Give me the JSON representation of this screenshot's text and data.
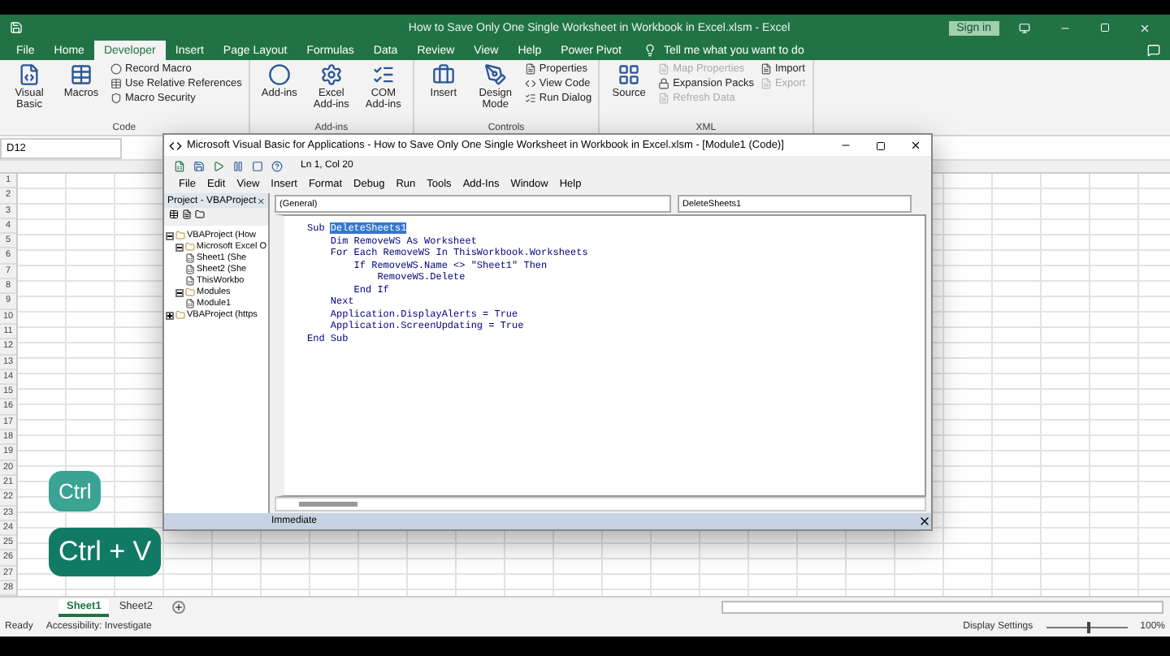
{
  "excel": {
    "title": "How to Save Only One Single Worksheet in Workbook in Excel.xlsm  -  Excel",
    "sign_in": "Sign in",
    "tabs": [
      {
        "label": "File",
        "selected": false
      },
      {
        "label": "Home",
        "selected": false
      },
      {
        "label": "Developer",
        "selected": true
      },
      {
        "label": "Insert",
        "selected": false
      },
      {
        "label": "Page Layout",
        "selected": false
      },
      {
        "label": "Formulas",
        "selected": false
      },
      {
        "label": "Data",
        "selected": false
      },
      {
        "label": "Review",
        "selected": false
      },
      {
        "label": "View",
        "selected": false
      },
      {
        "label": "Help",
        "selected": false
      },
      {
        "label": "Power Pivot",
        "selected": false
      }
    ],
    "tell_me": "Tell me what you want to do",
    "ribbon_groups": [
      {
        "name": "Code",
        "large": [
          "Visual Basic",
          "Macros"
        ],
        "small_columns": [
          [
            {
              "label": "Record Macro",
              "disabled": false
            },
            {
              "label": "Use Relative References",
              "disabled": false
            },
            {
              "label": "Macro Security",
              "disabled": false
            }
          ]
        ]
      },
      {
        "name": "Add-ins",
        "large": [
          "Add-ins",
          "Excel Add-ins",
          "COM Add-ins"
        ]
      },
      {
        "name": "Controls",
        "large": [
          "Insert",
          "Design Mode"
        ],
        "small_columns": [
          [
            {
              "label": "Properties",
              "disabled": false
            },
            {
              "label": "View Code",
              "disabled": false
            },
            {
              "label": "Run Dialog",
              "disabled": false
            }
          ]
        ]
      },
      {
        "name": "XML",
        "large": [
          "Source"
        ],
        "small_columns": [
          [
            {
              "label": "Map Properties",
              "disabled": true
            },
            {
              "label": "Expansion Packs",
              "disabled": false
            },
            {
              "label": "Refresh Data",
              "disabled": true
            }
          ],
          [
            {
              "label": "Import",
              "disabled": false
            },
            {
              "label": "Export",
              "disabled": true
            }
          ]
        ]
      }
    ],
    "name_box": "D12",
    "rows": [
      "1",
      "2",
      "3",
      "4",
      "5",
      "6",
      "7",
      "8",
      "9",
      "10",
      "11",
      "12",
      "13",
      "14",
      "15",
      "16",
      "17",
      "18",
      "19",
      "20",
      "21",
      "22",
      "23",
      "24",
      "25",
      "26",
      "27",
      "28"
    ],
    "sheets": [
      {
        "label": "Sheet1",
        "selected": true
      },
      {
        "label": "Sheet2",
        "selected": false
      }
    ],
    "status": {
      "ready": "Ready",
      "accessibility": "Accessibility: Investigate",
      "display_settings": "Display Settings",
      "zoom": "100%",
      "zoom_slider": {
        "level": 0.5
      }
    }
  },
  "vba": {
    "title": "Microsoft Visual Basic for Applications - How to Save Only One Single Worksheet in Workbook in Excel.xlsm - [Module1 (Code)]",
    "position": "Ln 1, Col 20",
    "menu": [
      "File",
      "Edit",
      "View",
      "Insert",
      "Format",
      "Debug",
      "Run",
      "Tools",
      "Add-Ins",
      "Window",
      "Help"
    ],
    "project_title": "Project - VBAProject",
    "tree": [
      {
        "label": "VBAProject (How",
        "expanded": true,
        "children": [
          {
            "label": "Microsoft Excel O",
            "expanded": true,
            "children": [
              {
                "label": "Sheet1 (She"
              },
              {
                "label": "Sheet2 (She"
              },
              {
                "label": "ThisWorkbo"
              }
            ]
          },
          {
            "label": "Modules",
            "expanded": true,
            "children": [
              {
                "label": "Module1"
              }
            ]
          }
        ]
      },
      {
        "label": "VBAProject (https",
        "expanded": false
      }
    ],
    "object_combo": "(General)",
    "procedure_combo": "DeleteSheets1",
    "code_lines": [
      {
        "text": "Sub ",
        "selection": "DeleteSheets1"
      },
      {
        "text": "    Dim RemoveWS As Worksheet"
      },
      {
        "text": "    For Each RemoveWS In ThisWorkbook.Worksheets"
      },
      {
        "text": "        If RemoveWS.Name <> \"Sheet1\" Then"
      },
      {
        "text": "            RemoveWS.Delete"
      },
      {
        "text": "        End If"
      },
      {
        "text": "    Next"
      },
      {
        "text": "    Application.DisplayAlerts = True"
      },
      {
        "text": "    Application.ScreenUpdating = True"
      },
      {
        "text": "End Sub"
      }
    ],
    "immediate": "Immediate"
  },
  "key_overlays": [
    "Ctrl",
    "Ctrl + V"
  ]
}
